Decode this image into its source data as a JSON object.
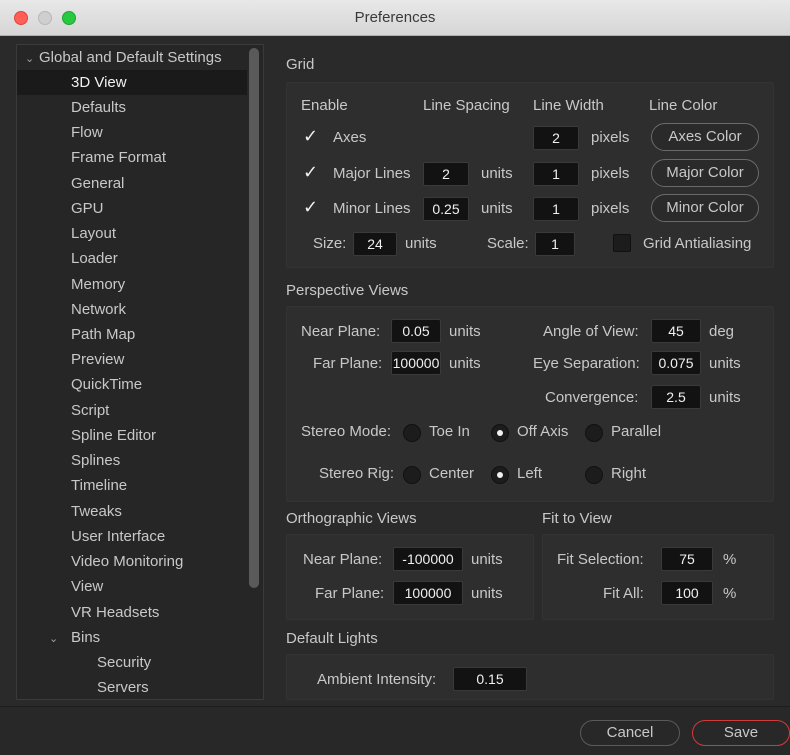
{
  "window": {
    "title": "Preferences"
  },
  "sidebar": {
    "items": [
      {
        "label": "Global and Default Settings",
        "chev": "⌄"
      },
      {
        "label": "3D View"
      },
      {
        "label": "Defaults"
      },
      {
        "label": "Flow"
      },
      {
        "label": "Frame Format"
      },
      {
        "label": "General"
      },
      {
        "label": "GPU"
      },
      {
        "label": "Layout"
      },
      {
        "label": "Loader"
      },
      {
        "label": "Memory"
      },
      {
        "label": "Network"
      },
      {
        "label": "Path Map"
      },
      {
        "label": "Preview"
      },
      {
        "label": "QuickTime"
      },
      {
        "label": "Script"
      },
      {
        "label": "Spline Editor"
      },
      {
        "label": "Splines"
      },
      {
        "label": "Timeline"
      },
      {
        "label": "Tweaks"
      },
      {
        "label": "User Interface"
      },
      {
        "label": "Video Monitoring"
      },
      {
        "label": "View"
      },
      {
        "label": "VR Headsets"
      },
      {
        "label": "Bins",
        "chev": "⌄"
      },
      {
        "label": "Security"
      },
      {
        "label": "Servers"
      }
    ]
  },
  "grid": {
    "title": "Grid",
    "headers": {
      "enable": "Enable",
      "spacing": "Line Spacing",
      "width": "Line Width",
      "color": "Line Color"
    },
    "axes": {
      "label": "Axes",
      "width": "2",
      "width_unit": "pixels",
      "color_btn": "Axes Color"
    },
    "major": {
      "label": "Major Lines",
      "spacing": "2",
      "spacing_unit": "units",
      "width": "1",
      "width_unit": "pixels",
      "color_btn": "Major Color"
    },
    "minor": {
      "label": "Minor Lines",
      "spacing": "0.25",
      "spacing_unit": "units",
      "width": "1",
      "width_unit": "pixels",
      "color_btn": "Minor Color"
    },
    "size": {
      "label": "Size:",
      "value": "24",
      "unit": "units"
    },
    "scale": {
      "label": "Scale:",
      "value": "1"
    },
    "antialias": {
      "label": "Grid Antialiasing"
    }
  },
  "perspective": {
    "title": "Perspective Views",
    "near": {
      "label": "Near Plane:",
      "value": "0.05",
      "unit": "units"
    },
    "far": {
      "label": "Far Plane:",
      "value": "100000",
      "unit": "units"
    },
    "angle": {
      "label": "Angle of View:",
      "value": "45",
      "unit": "deg"
    },
    "eye": {
      "label": "Eye Separation:",
      "value": "0.075",
      "unit": "units"
    },
    "conv": {
      "label": "Convergence:",
      "value": "2.5",
      "unit": "units"
    },
    "stereo_mode": {
      "label": "Stereo Mode:",
      "opt1": "Toe In",
      "opt2": "Off Axis",
      "opt3": "Parallel"
    },
    "stereo_rig": {
      "label": "Stereo Rig:",
      "opt1": "Center",
      "opt2": "Left",
      "opt3": "Right"
    }
  },
  "ortho": {
    "title": "Orthographic Views",
    "near": {
      "label": "Near Plane:",
      "value": "-100000",
      "unit": "units"
    },
    "far": {
      "label": "Far Plane:",
      "value": "100000",
      "unit": "units"
    }
  },
  "fit": {
    "title": "Fit to View",
    "selection": {
      "label": "Fit Selection:",
      "value": "75",
      "unit": "%"
    },
    "all": {
      "label": "Fit All:",
      "value": "100",
      "unit": "%"
    }
  },
  "lights": {
    "title": "Default Lights",
    "ambient": {
      "label": "Ambient Intensity:",
      "value": "0.15"
    }
  },
  "footer": {
    "cancel": "Cancel",
    "save": "Save"
  }
}
